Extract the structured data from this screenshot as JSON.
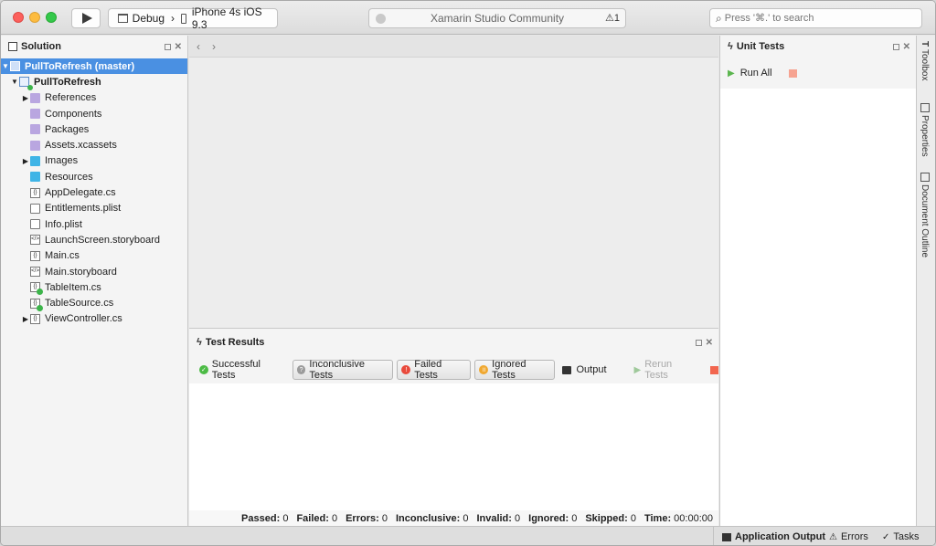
{
  "toolbar": {
    "configuration": "Debug",
    "device": "iPhone 4s iOS 9.3",
    "status_text": "Xamarin Studio Community",
    "warning_count": "1",
    "search_placeholder": "Press '⌘.' to search"
  },
  "solution": {
    "title": "Solution",
    "items": [
      {
        "label": "PullToRefresh (master)"
      },
      {
        "label": "PullToRefresh"
      },
      {
        "label": "References"
      },
      {
        "label": "Components"
      },
      {
        "label": "Packages"
      },
      {
        "label": "Assets.xcassets"
      },
      {
        "label": "Images"
      },
      {
        "label": "Resources"
      },
      {
        "label": "AppDelegate.cs"
      },
      {
        "label": "Entitlements.plist"
      },
      {
        "label": "Info.plist"
      },
      {
        "label": "LaunchScreen.storyboard"
      },
      {
        "label": "Main.cs"
      },
      {
        "label": "Main.storyboard"
      },
      {
        "label": "TableItem.cs"
      },
      {
        "label": "TableSource.cs"
      },
      {
        "label": "ViewController.cs"
      }
    ]
  },
  "test_results": {
    "title": "Test Results",
    "buttons": {
      "successful": "Successful Tests",
      "inconclusive": "Inconclusive Tests",
      "failed": "Failed Tests",
      "ignored": "Ignored Tests",
      "output": "Output",
      "rerun": "Rerun Tests"
    },
    "summary": {
      "passed_label": "Passed:",
      "passed": "0",
      "failed_label": "Failed:",
      "failed": "0",
      "errors_label": "Errors:",
      "errors": "0",
      "inconclusive_label": "Inconclusive:",
      "inconclusive": "0",
      "invalid_label": "Invalid:",
      "invalid": "0",
      "ignored_label": "Ignored:",
      "ignored": "0",
      "skipped_label": "Skipped:",
      "skipped": "0",
      "time_label": "Time:",
      "time": "00:00:00"
    }
  },
  "unit_tests": {
    "title": "Unit Tests",
    "run_all": "Run All"
  },
  "dock": {
    "toolbox": "Toolbox",
    "properties": "Properties",
    "document_outline": "Document Outline"
  },
  "statusbar": {
    "application_output": "Application Output",
    "errors": "Errors",
    "tasks": "Tasks"
  }
}
